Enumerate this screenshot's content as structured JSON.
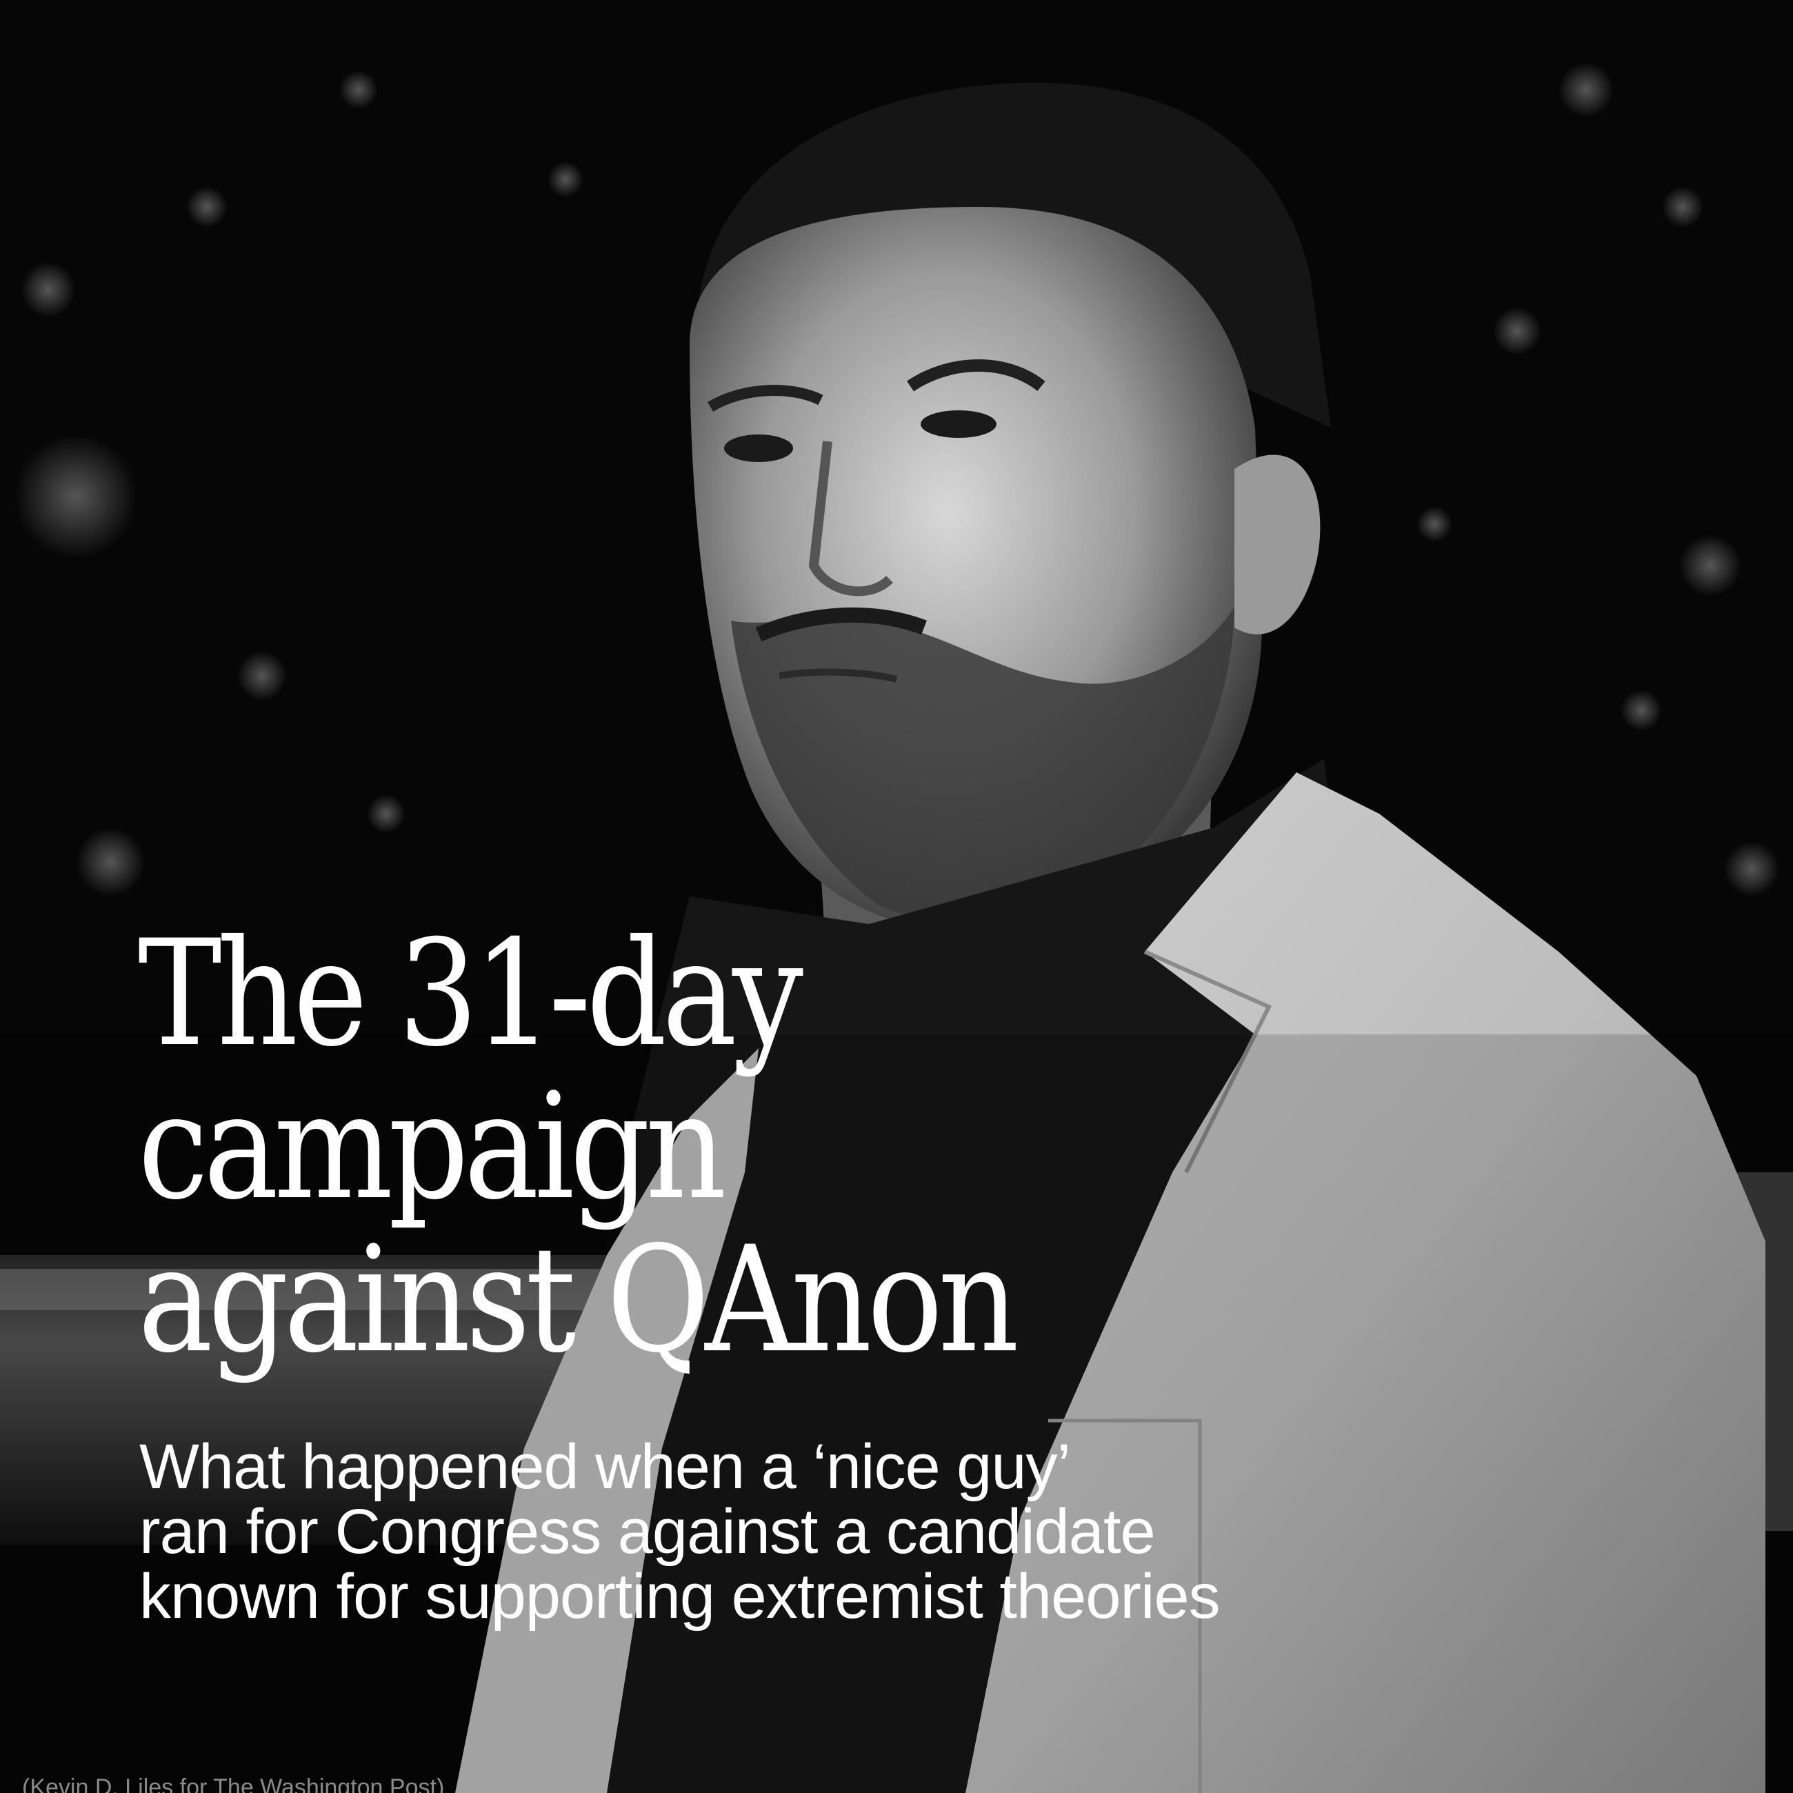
{
  "headline": {
    "lines": [
      "The 31-day",
      "campaign",
      "against QAnon"
    ]
  },
  "dek": {
    "lines": [
      "What happened when a ‘nice guy’",
      "ran for Congress against a candidate",
      "known for supporting extremist theories"
    ]
  },
  "credit": "(Kevin D. Liles for The Washington Post)",
  "colors": {
    "background": "#050505",
    "headline_text": "#ffffff",
    "credit_text": "#8a8a8a"
  }
}
